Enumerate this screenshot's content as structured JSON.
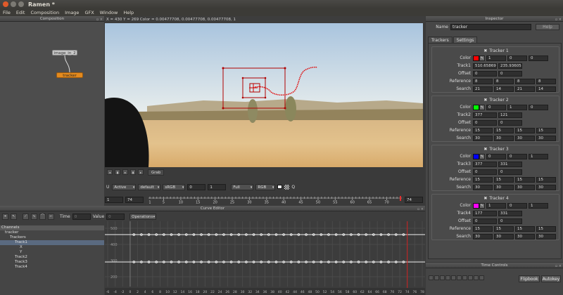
{
  "app": {
    "title": "Ramen *"
  },
  "menu": [
    "File",
    "Edit",
    "Composition",
    "Image",
    "GFX",
    "Window",
    "Help"
  ],
  "composition": {
    "title": "Composition",
    "nodes": {
      "image": "image_in_2",
      "tracker": "tracker"
    }
  },
  "viewer": {
    "info": "X = 430 Y = 269 Color = 0.00477708, 0.00477708, 0.00477708, 1",
    "grab_label": "Grab",
    "channel_u": "U",
    "mode": "Active",
    "ocio": "default",
    "colorspace": "sRGB",
    "exposure": "0",
    "gamma": "1",
    "resolution": "Full",
    "channels": "RGB",
    "q_label": "Q",
    "frame_start": "1",
    "frame_end_left": "74",
    "frame_current": "74",
    "ruler_ticks": [
      "1",
      "5",
      "10",
      "15",
      "20",
      "25",
      "30",
      "35",
      "40",
      "45",
      "50",
      "55",
      "60",
      "65",
      "70"
    ]
  },
  "curve_editor": {
    "title": "Curve Editor",
    "time_label": "Time",
    "time_value": "0",
    "value_label": "Value",
    "value_value": "0",
    "operations_label": "Operations",
    "channels": [
      {
        "label": "Channels",
        "indent": 0,
        "header": true
      },
      {
        "label": "tracker",
        "indent": 1
      },
      {
        "label": "Trackers",
        "indent": 2
      },
      {
        "label": "Track1",
        "indent": 3,
        "selected": true
      },
      {
        "label": "X",
        "indent": 4
      },
      {
        "label": "Y",
        "indent": 4
      },
      {
        "label": "Track2",
        "indent": 3
      },
      {
        "label": "Track3",
        "indent": 3
      },
      {
        "label": "Track4",
        "indent": 3
      }
    ],
    "y_labels": [
      "500",
      "400",
      "300",
      "200"
    ],
    "x_ticks": [
      "-6",
      "-4",
      "-2",
      "0",
      "2",
      "4",
      "6",
      "8",
      "10",
      "12",
      "14",
      "16",
      "18",
      "20",
      "22",
      "24",
      "26",
      "28",
      "30",
      "32",
      "34",
      "36",
      "38",
      "40",
      "42",
      "44",
      "46",
      "48",
      "50",
      "52",
      "54",
      "56",
      "58",
      "60",
      "62",
      "64",
      "66",
      "68",
      "70",
      "72",
      "74",
      "76",
      "78"
    ]
  },
  "inspector": {
    "title": "Inspector",
    "name_label": "Name",
    "name_value": "tracker",
    "help_label": "Help",
    "tabs": [
      "Trackers",
      "Settings"
    ],
    "labels": {
      "color": "Color",
      "offset": "Offset",
      "reference": "Reference",
      "search": "Search"
    },
    "trackers": [
      {
        "title": "Tracker 1",
        "color": "#ff0000",
        "color_vals": [
          "1",
          "0",
          "0"
        ],
        "track_label": "Track1",
        "track": [
          "510.65869",
          "235.93605"
        ],
        "offset": [
          "0",
          "0"
        ],
        "reference": [
          "8",
          "8",
          "8",
          "8"
        ],
        "search": [
          "21",
          "14",
          "21",
          "14"
        ]
      },
      {
        "title": "Tracker 2",
        "color": "#00ff00",
        "color_vals": [
          "0",
          "1",
          "0"
        ],
        "track_label": "Track2",
        "track": [
          "377",
          "121"
        ],
        "offset": [
          "0",
          "0"
        ],
        "reference": [
          "15",
          "15",
          "15",
          "15"
        ],
        "search": [
          "30",
          "30",
          "30",
          "30"
        ]
      },
      {
        "title": "Tracker 3",
        "color": "#0000ff",
        "color_vals": [
          "0",
          "0",
          "1"
        ],
        "track_label": "Track3",
        "track": [
          "377",
          "331"
        ],
        "offset": [
          "0",
          "0"
        ],
        "reference": [
          "15",
          "15",
          "15",
          "15"
        ],
        "search": [
          "30",
          "30",
          "30",
          "30"
        ]
      },
      {
        "title": "Tracker 4",
        "color": "#ff00ff",
        "color_vals": [
          "1",
          "0",
          "1"
        ],
        "track_label": "Track4",
        "track": [
          "177",
          "331"
        ],
        "offset": [
          "0",
          "0"
        ],
        "reference": [
          "15",
          "15",
          "15",
          "15"
        ],
        "search": [
          "30",
          "30",
          "30",
          "30"
        ]
      }
    ]
  },
  "time_controls": {
    "title": "Time Controls",
    "flipbook_label": "Flipbook",
    "autokey_label": "Autokey"
  }
}
